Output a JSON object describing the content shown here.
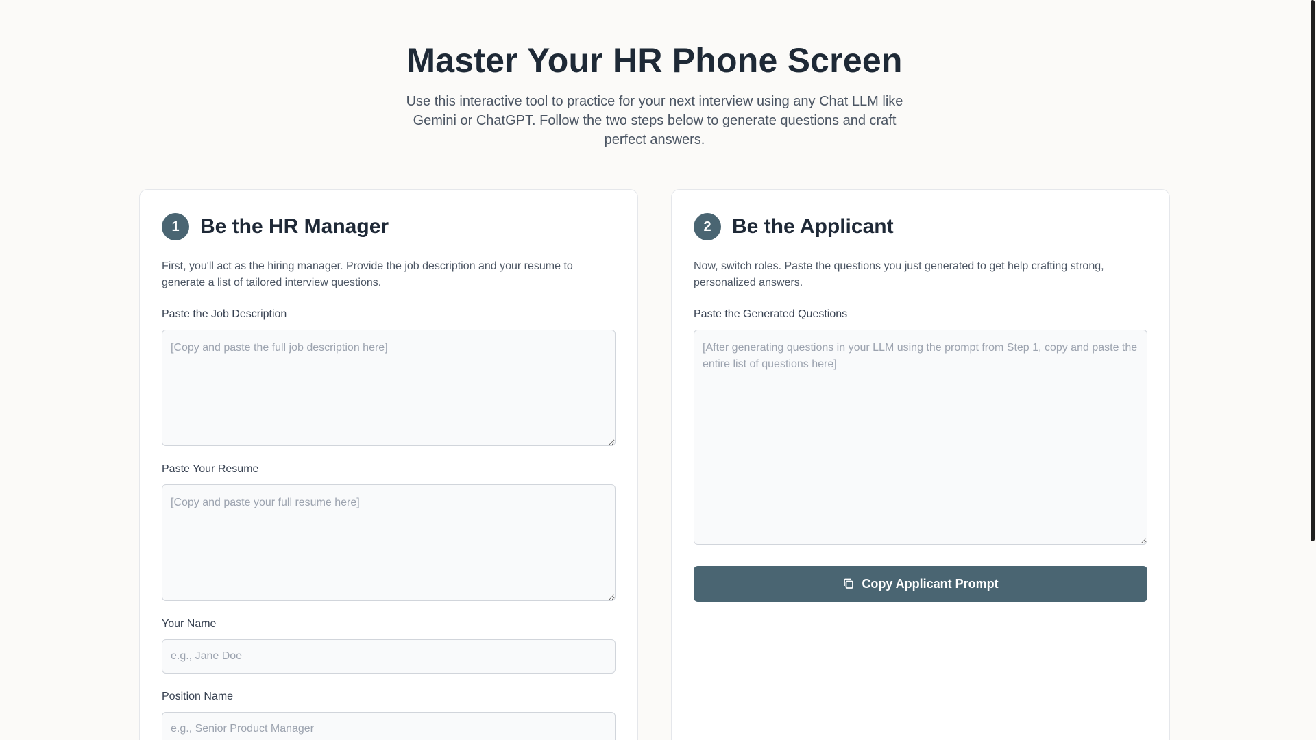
{
  "hero": {
    "title": "Master Your HR Phone Screen",
    "subtitle": "Use this interactive tool to practice for your next interview using any Chat LLM like Gemini or ChatGPT. Follow the two steps below to generate questions and craft perfect answers."
  },
  "step1": {
    "number": "1",
    "title": "Be the HR Manager",
    "description": "First, you'll act as the hiring manager. Provide the job description and your resume to generate a list of tailored interview questions.",
    "job_label": "Paste the Job Description",
    "job_placeholder": "[Copy and paste the full job description here]",
    "resume_label": "Paste Your Resume",
    "resume_placeholder": "[Copy and paste your full resume here]",
    "name_label": "Your Name",
    "name_placeholder": "e.g., Jane Doe",
    "position_label": "Position Name",
    "position_placeholder": "e.g., Senior Product Manager"
  },
  "step2": {
    "number": "2",
    "title": "Be the Applicant",
    "description": "Now, switch roles. Paste the questions you just generated to get help crafting strong, personalized answers.",
    "questions_label": "Paste the Generated Questions",
    "questions_placeholder": "[After generating questions in your LLM using the prompt from Step 1, copy and paste the entire list of questions here]",
    "copy_button_label": "Copy Applicant Prompt",
    "copy_icon": "copy-icon"
  },
  "colors": {
    "accent": "#4a6572",
    "background": "#fbfaf8",
    "card": "#ffffff"
  }
}
